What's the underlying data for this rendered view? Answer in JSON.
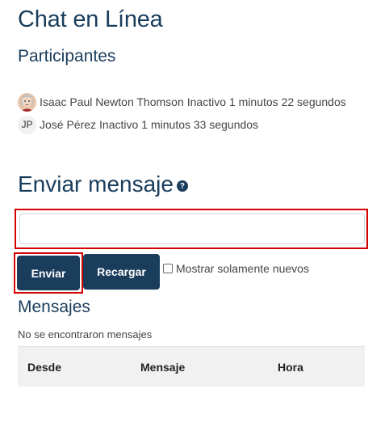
{
  "page": {
    "title": "Chat en Línea",
    "participants_heading": "Participantes"
  },
  "participants": [
    {
      "name": "Isaac Paul Newton Thomson",
      "status": "Inactivo",
      "idle": "1 minutos 22 segundos",
      "avatar": "photo"
    },
    {
      "name": "José Pérez",
      "status": "Inactivo",
      "idle": "1 minutos 33 segundos",
      "avatar_initials": "JP"
    }
  ],
  "send": {
    "heading": "Enviar mensaje",
    "help_icon": "question-circle-icon",
    "input_placeholder": "",
    "send_label": "Enviar",
    "reload_label": "Recargar",
    "only_new_label": "Mostrar solamente nuevos",
    "only_new_checked": false
  },
  "messages": {
    "heading": "Mensajes",
    "empty_text": "No se encontraron mensajes",
    "columns": [
      "Desde",
      "Mensaje",
      "Hora"
    ]
  },
  "colors": {
    "heading": "#1a3d5c",
    "button_bg": "#1a3d5c",
    "highlight_border": "#d40000",
    "table_header_bg": "#f1f1f1"
  }
}
